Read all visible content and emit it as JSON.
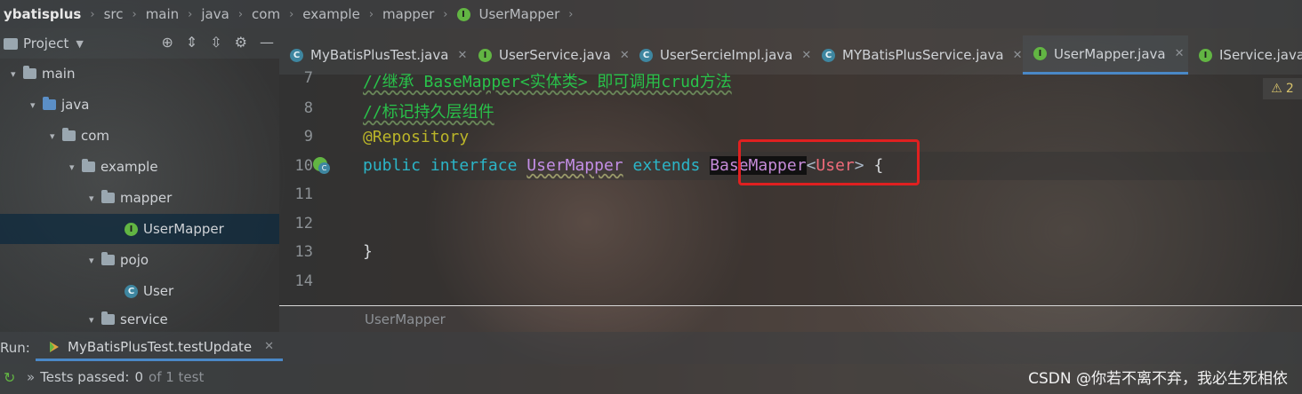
{
  "breadcrumb": {
    "items": [
      "ybatisplus",
      "src",
      "main",
      "java",
      "com",
      "example",
      "mapper",
      "UserMapper"
    ]
  },
  "project_panel": {
    "title": "Project",
    "tree": [
      {
        "label": "main",
        "type": "folder"
      },
      {
        "label": "java",
        "type": "source-folder"
      },
      {
        "label": "com",
        "type": "package"
      },
      {
        "label": "example",
        "type": "package"
      },
      {
        "label": "mapper",
        "type": "package"
      },
      {
        "label": "UserMapper",
        "type": "interface",
        "selected": true
      },
      {
        "label": "pojo",
        "type": "package"
      },
      {
        "label": "User",
        "type": "class"
      },
      {
        "label": "service",
        "type": "package"
      }
    ]
  },
  "tabs": [
    {
      "label": "MyBatisPlusTest.java",
      "icon": "test-class-icon"
    },
    {
      "label": "UserService.java",
      "icon": "interface-icon"
    },
    {
      "label": "UserSercieImpl.java",
      "icon": "class-icon"
    },
    {
      "label": "MYBatisPlusService.java",
      "icon": "spring-class-icon"
    },
    {
      "label": "UserMapper.java",
      "icon": "interface-icon",
      "active": true
    },
    {
      "label": "IService.java",
      "icon": "interface-lock-icon"
    }
  ],
  "editor": {
    "lines": [
      "7",
      "8",
      "9",
      "10",
      "11",
      "12",
      "13",
      "14"
    ],
    "code": {
      "line7": "//继承 BaseMapper<实体类> 即可调用crud方法",
      "line8": "//标记持久层组件",
      "line9": "@Repository",
      "line10_kw1": "public",
      "line10_kw2": "interface",
      "line10_name": "UserMapper",
      "line10_kw3": "extends",
      "line10_base": "BaseMapper",
      "line10_lt": "<",
      "line10_generic": "User",
      "line10_gt": ">",
      "line10_brace": "{",
      "line13": "}"
    },
    "warning_count": "2",
    "structure_crumb": "UserMapper"
  },
  "run": {
    "label": "Run:",
    "tab": "MyBatisPlusTest.testUpdate",
    "status_prefix": "Tests passed:",
    "passed": "0",
    "status_suffix": "of 1 test"
  },
  "watermark": "CSDN @你若不离不弃，我必生死相依",
  "colors": {
    "accent": "#4a88c7",
    "highlight_box": "#e02020",
    "comment": "#29c24a",
    "keyword": "#2bb5c8"
  }
}
